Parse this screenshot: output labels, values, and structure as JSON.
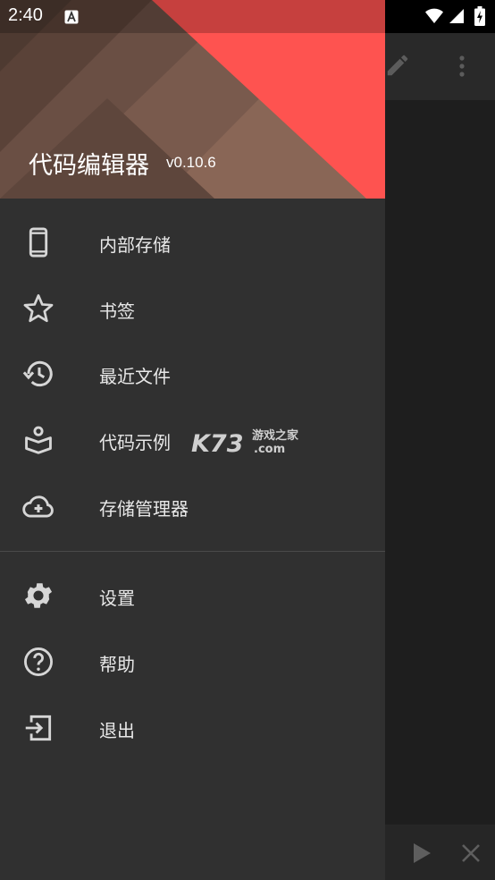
{
  "status_bar": {
    "time": "2:40"
  },
  "drawer": {
    "app_title": "代码编辑器",
    "version": "v0.10.6",
    "menu_primary": [
      {
        "label": "内部存储",
        "icon": "phone-icon"
      },
      {
        "label": "书签",
        "icon": "star-icon"
      },
      {
        "label": "最近文件",
        "icon": "history-icon"
      },
      {
        "label": "代码示例",
        "icon": "book-icon"
      },
      {
        "label": "存储管理器",
        "icon": "cloud-add-icon"
      }
    ],
    "menu_secondary": [
      {
        "label": "设置",
        "icon": "gear-icon"
      },
      {
        "label": "帮助",
        "icon": "help-icon"
      },
      {
        "label": "退出",
        "icon": "exit-icon"
      }
    ]
  },
  "watermark": {
    "brand": "K73",
    "site_top": "游戏之家",
    "site_bottom": ".com"
  },
  "colors": {
    "accent_red": "#fe5350",
    "drawer_bg": "#303030",
    "header_brown": "#6e5247"
  }
}
